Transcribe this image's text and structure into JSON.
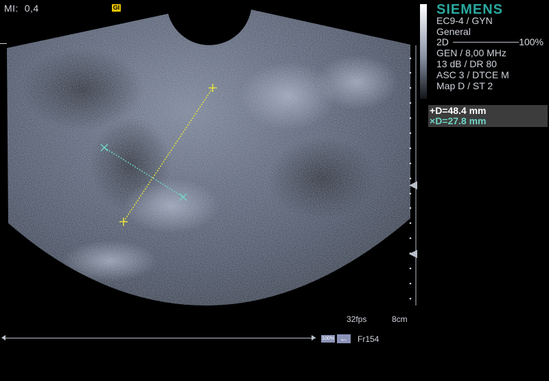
{
  "header": {
    "mi_label": "MI:",
    "mi_value": "0,4",
    "gi_badge": "GI"
  },
  "system": {
    "brand": "SIEMENS",
    "transducer": "EC9-4 / GYN",
    "preset": "General",
    "mode": "2D",
    "power": "100%",
    "params": [
      "GEN / 8,00 MHz",
      "13 dB / DR 80",
      "ASC 3 / DTCE M",
      "Map D / ST 2"
    ]
  },
  "measurements": [
    {
      "marker": "+",
      "label": "D=48.4 mm",
      "color": "#ffffff"
    },
    {
      "marker": "×",
      "label": "D=27.8 mm",
      "color": "#6fd3c4"
    }
  ],
  "footer": {
    "fps": "32fps",
    "depth": "8cm",
    "zoom": "100%",
    "frame": "Fr154"
  },
  "colors": {
    "brand": "#2aa9a0",
    "caliper1": "#e8e23a",
    "caliper2": "#6fd3c4"
  },
  "icons": [
    "gi-icon",
    "back-arrow-icon",
    "focus-marker-icon"
  ]
}
